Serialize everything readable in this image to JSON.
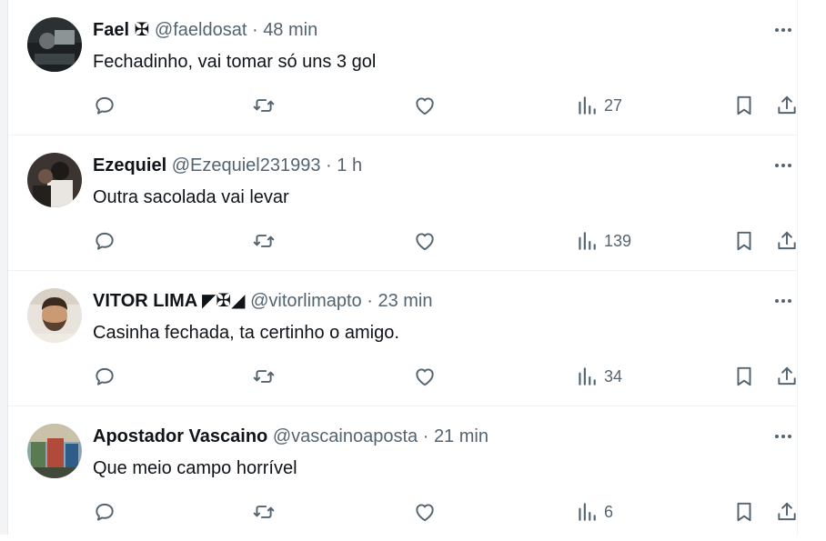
{
  "tweets": [
    {
      "name": "Fael ✠",
      "handle": "@faeldosat",
      "time": "48 min",
      "text": "Fechadinho, vai tomar só uns 3 gol",
      "views": "27",
      "avatar_color": "#2b3133"
    },
    {
      "name": "Ezequiel",
      "handle": "@Ezequiel231993",
      "time": "1 h",
      "text": "Outra sacolada vai levar",
      "views": "139",
      "avatar_color": "#3b3431"
    },
    {
      "name": "VITOR LIMA ◤✠◢",
      "handle": "@vitorlimapto",
      "time": "23 min",
      "text": "Casinha fechada, ta certinho o amigo.",
      "views": "34",
      "avatar_color": "#c99a74"
    },
    {
      "name": "Apostador Vascaino",
      "handle": "@vascainoaposta",
      "time": "21 min",
      "text": "Que meio campo horrível",
      "views": "6",
      "avatar_color": "#5a7a52"
    }
  ],
  "colors": {
    "icon": "#536471",
    "text": "#0f1419",
    "divider": "#eff3f4"
  },
  "icons": {
    "reply": "reply-icon",
    "retweet": "retweet-icon",
    "like": "heart-icon",
    "views": "views-chart-icon",
    "bookmark": "bookmark-icon",
    "share": "share-icon",
    "more": "more-dots-icon"
  }
}
